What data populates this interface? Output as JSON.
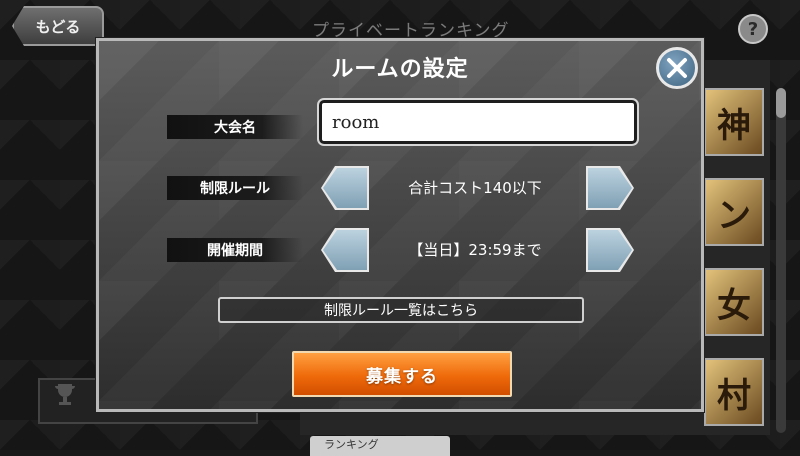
{
  "background": {
    "back_label": "もどる",
    "heading": "プライベートランキング",
    "help_label": "?",
    "cards": [
      "神",
      "ン",
      "女",
      "村"
    ],
    "bottom_tab": "ランキング"
  },
  "modal": {
    "title": "ルームの設定",
    "name_label": "大会名",
    "name_value": "room",
    "rule_label": "制限ルール",
    "rule_value": "合計コスト140以下",
    "period_label": "開催期間",
    "period_value": "【当日】23:59まで",
    "rules_link": "制限ルール一覧はこちら",
    "submit_label": "募集する"
  },
  "colors": {
    "accent_orange": "#ef6a0a",
    "arrow_blue": "#9fbccd",
    "close_blue": "#4f7897"
  }
}
